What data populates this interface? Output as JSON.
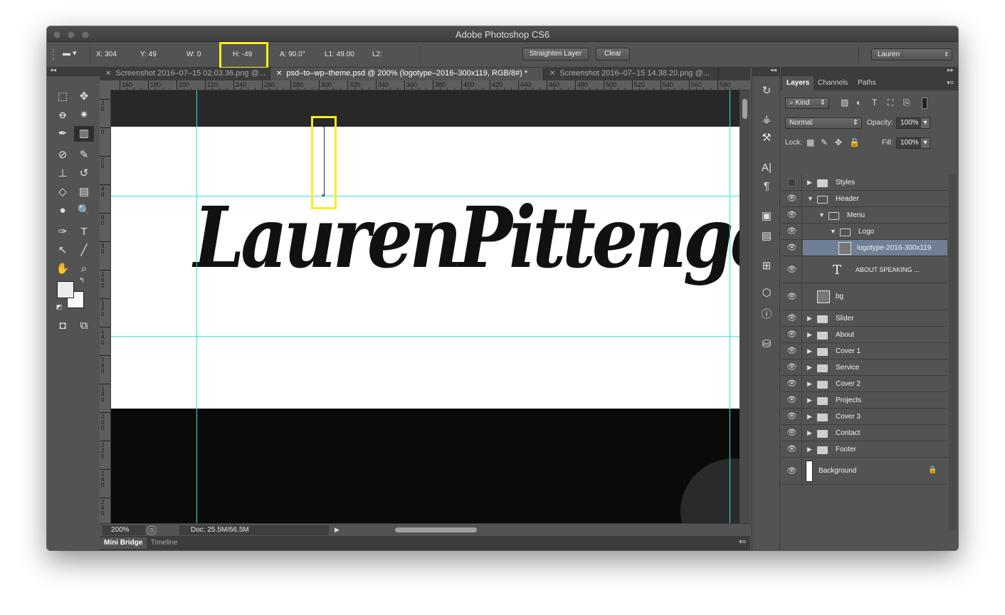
{
  "window": {
    "title": "Adobe Photoshop CS6"
  },
  "options_bar": {
    "x": "X: 304",
    "y": "Y: 49",
    "w": "W: 0",
    "h": "H: -49",
    "a": "A: 90.0°",
    "l1": "L1: 49.00",
    "l2": "L2:",
    "straighten_label": "Straighten Layer",
    "clear_label": "Clear",
    "workspace": "Lauren",
    "highlight_color": "#f6ee1d"
  },
  "doc_tabs": [
    {
      "label": "Screenshot 2016–07–15 02.03.36.png @...",
      "active": false
    },
    {
      "label": "psd–to–wp–theme.psd @ 200% (logotype–2016–300x119, RGB/8#) *",
      "active": true
    },
    {
      "label": "Screenshot 2016–07–15 14.38.20.png @...",
      "active": false
    }
  ],
  "ruler": {
    "top_labels": [
      "160",
      "180",
      "200",
      "220",
      "240",
      "260",
      "280",
      "300",
      "320",
      "340",
      "360",
      "380",
      "400",
      "420",
      "440",
      "460",
      "480",
      "500",
      "520",
      "540",
      "560",
      "580"
    ],
    "left_labels": [
      "2 0",
      "0",
      "2 0",
      "4 0",
      "6 0",
      "8 0",
      "1 0 0",
      "1 2 0",
      "1 4 0",
      "1 6 0",
      "1 8 0",
      "2 0 0",
      "2 2 0",
      "2 4 0",
      "2 6 0"
    ]
  },
  "canvas": {
    "logo_text": "LaurenPittenger",
    "guide_color": "#2ee6e6"
  },
  "status": {
    "zoom": "200%",
    "doc": "Doc: 25.5M/66.5M"
  },
  "bottom_tabs": [
    "Mini Bridge",
    "Timeline"
  ],
  "layers_panel": {
    "tabs": [
      "Layers",
      "Channels",
      "Paths"
    ],
    "kind_label": "Kind",
    "blend_mode": "Normal",
    "opacity_label": "Opacity:",
    "opacity_value": "100%",
    "lock_label": "Lock:",
    "fill_label": "Fill:",
    "fill_value": "100%",
    "layers": [
      {
        "name": "Styles",
        "type": "folder",
        "indent": 0,
        "expanded": false,
        "visible": false
      },
      {
        "name": "Header",
        "type": "folder",
        "indent": 0,
        "expanded": true,
        "visible": true
      },
      {
        "name": "Menu",
        "type": "folder",
        "indent": 1,
        "expanded": true,
        "visible": true
      },
      {
        "name": "Logo",
        "type": "folder",
        "indent": 2,
        "expanded": true,
        "visible": true
      },
      {
        "name": "logotype-2016-300x119",
        "type": "smart",
        "indent": 3,
        "visible": true,
        "selected": true
      },
      {
        "name": "ABOUT       SPEAKING   ...",
        "type": "text",
        "indent": 2,
        "visible": true
      },
      {
        "name": "bg",
        "type": "smart",
        "indent": 1,
        "visible": true
      },
      {
        "name": "Slider",
        "type": "folder",
        "indent": 0,
        "expanded": false,
        "visible": true
      },
      {
        "name": "About",
        "type": "folder",
        "indent": 0,
        "expanded": false,
        "visible": true
      },
      {
        "name": "Cover 1",
        "type": "folder",
        "indent": 0,
        "expanded": false,
        "visible": true
      },
      {
        "name": "Service",
        "type": "folder",
        "indent": 0,
        "expanded": false,
        "visible": true
      },
      {
        "name": "Cover 2",
        "type": "folder",
        "indent": 0,
        "expanded": false,
        "visible": true
      },
      {
        "name": "Projects",
        "type": "folder",
        "indent": 0,
        "expanded": false,
        "visible": true
      },
      {
        "name": "Cover 3",
        "type": "folder",
        "indent": 0,
        "expanded": false,
        "visible": true
      },
      {
        "name": "Contact",
        "type": "folder",
        "indent": 0,
        "expanded": false,
        "visible": true
      },
      {
        "name": "Footer",
        "type": "folder",
        "indent": 0,
        "expanded": false,
        "visible": true
      },
      {
        "name": "Background",
        "type": "background",
        "indent": 0,
        "visible": true,
        "locked": true
      }
    ]
  }
}
